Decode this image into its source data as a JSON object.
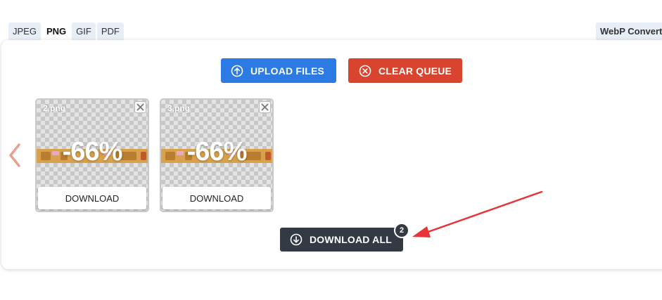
{
  "format_tabs": [
    "JPEG",
    "PNG",
    "GIF",
    "PDF"
  ],
  "active_format": "PNG",
  "webp_tab": "WebP Converter",
  "actions": {
    "upload_label": "UPLOAD FILES",
    "clear_label": "CLEAR QUEUE",
    "download_all_label": "DOWNLOAD ALL",
    "queue_count": "2"
  },
  "files": [
    {
      "name": "2.png",
      "saving": "-66%",
      "download_label": "DOWNLOAD"
    },
    {
      "name": "3.png",
      "saving": "-66%",
      "download_label": "DOWNLOAD"
    }
  ],
  "colors": {
    "upload": "#2c7be5",
    "clear": "#d9442f",
    "download_all": "#333a44",
    "annotation_arrow": "#e8353a",
    "nav_arrow": "#e8a090"
  },
  "icons": {
    "upload": "arrow-up-circle-icon",
    "clear": "x-circle-icon",
    "download_all": "arrow-down-circle-icon",
    "remove_file": "close-icon",
    "prev": "chevron-left-icon"
  }
}
